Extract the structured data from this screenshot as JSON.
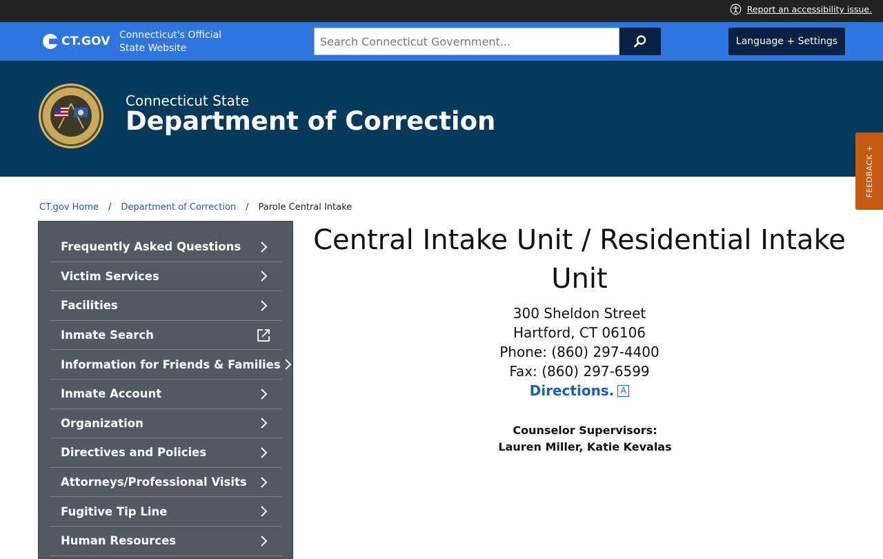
{
  "topbar": {
    "a11y_link": "Report an accessibility issue."
  },
  "ctheader": {
    "logo": "CT.GOV",
    "site_line1": "Connecticut's Official",
    "site_line2": "State Website",
    "search_placeholder": "Search Connecticut Government...",
    "language_button": "Language + Settings"
  },
  "banner": {
    "pre": "Connecticut State",
    "name": "Department of Correction"
  },
  "feedback": "FEEDBACK +",
  "breadcrumb": {
    "home": "CT.gov Home",
    "agency": "Department of Correction",
    "current": "Parole Central Intake",
    "separator": "/"
  },
  "sidebar": {
    "items": [
      {
        "label": "Frequently Asked Questions",
        "icon": "chevron-right-icon"
      },
      {
        "label": "Victim Services",
        "icon": "chevron-right-icon"
      },
      {
        "label": "Facilities",
        "icon": "chevron-right-icon"
      },
      {
        "label": "Inmate Search",
        "icon": "external-link-icon"
      },
      {
        "label": "Information for Friends & Families",
        "icon": "chevron-right-icon"
      },
      {
        "label": "Inmate Account",
        "icon": "chevron-right-icon"
      },
      {
        "label": "Organization",
        "icon": "chevron-right-icon"
      },
      {
        "label": "Directives and Policies",
        "icon": "chevron-right-icon"
      },
      {
        "label": "Attorneys/Professional Visits",
        "icon": "chevron-right-icon"
      },
      {
        "label": "Fugitive Tip Line",
        "icon": "chevron-right-icon"
      },
      {
        "label": "Human Resources",
        "icon": "chevron-right-icon"
      }
    ]
  },
  "main": {
    "title": "Central Intake Unit / Residential Intake Unit",
    "street": "300 Sheldon Street",
    "city": "Hartford, CT 06106",
    "phone": "Phone: (860) 297-4400",
    "fax": "Fax: (860) 297-6599",
    "directions": "Directions.",
    "directions_icon_letter": "A",
    "counselor_heading": "Counselor Supervisors:",
    "counselor_names": "Lauren Miller, Katie Kevalas"
  },
  "colors": {
    "topbar": "#222222",
    "ctbar": "#2e76dd",
    "navy": "#0b2246",
    "banner": "#063a5c",
    "sidebar": "#525a61",
    "link": "#1a5fb4",
    "feedback": "#c55a11"
  }
}
